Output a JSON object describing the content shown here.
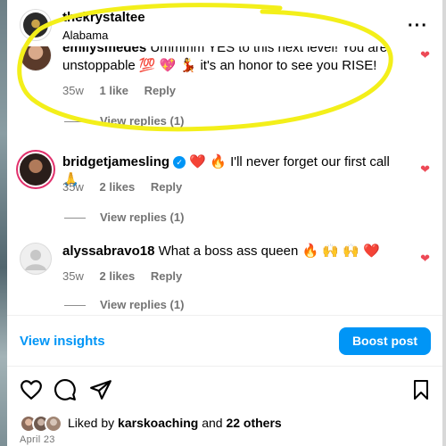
{
  "post": {
    "username": "thekrystaltee",
    "location": "Alabama",
    "more_icon": "more-horizontal-icon"
  },
  "comments": [
    {
      "username": "emilysmedes",
      "text": "Ummmm YES to this next level! You are unstoppable 💯 💖 💃 it's an honor to see you RISE!",
      "time": "35w",
      "likes": "1 like",
      "reply": "Reply",
      "view_replies": "View replies (1)",
      "liked": true
    },
    {
      "username": "bridgetjamesling",
      "verified": true,
      "text": "❤️ 🔥 I'll never forget our first call 🙏",
      "time": "35w",
      "likes": "2 likes",
      "reply": "Reply",
      "view_replies": "View replies (1)",
      "liked": true
    },
    {
      "username": "alyssabravo18",
      "text": "What a boss ass queen 🔥 🙌 🙌 ❤️",
      "time": "35w",
      "likes": "2 likes",
      "reply": "Reply",
      "view_replies": "View replies (1)",
      "liked": true
    }
  ],
  "insights_label": "View insights",
  "boost_label": "Boost post",
  "actions": {
    "like_icon": "heart-outline-icon",
    "comment_icon": "comment-icon",
    "share_icon": "send-icon",
    "save_icon": "bookmark-icon"
  },
  "likes_line": {
    "prefix": "Liked by",
    "user": "karskoaching",
    "middle": "and",
    "others": "22 others"
  },
  "date": "April 23",
  "colors": {
    "accent": "#0095f6",
    "heart": "#ed4956",
    "highlight": "#f3ef1a",
    "muted": "#737373"
  }
}
